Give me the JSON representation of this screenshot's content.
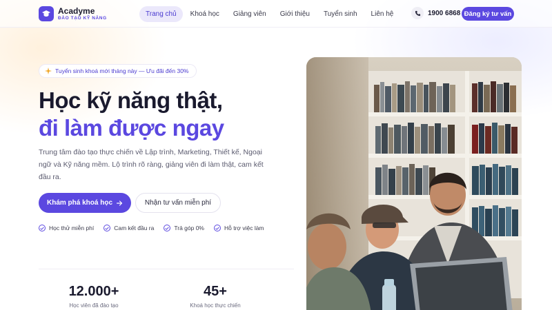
{
  "brand": {
    "name": "Acadyme",
    "tagline": "ĐÀO TẠO KỸ NĂNG",
    "accent": "#5b48e0"
  },
  "nav": {
    "items": [
      {
        "label": "Trang chủ",
        "active": true
      },
      {
        "label": "Khoá học",
        "active": false
      },
      {
        "label": "Giảng viên",
        "active": false
      },
      {
        "label": "Giới thiệu",
        "active": false
      },
      {
        "label": "Tuyển sinh",
        "active": false
      },
      {
        "label": "Liên hệ",
        "active": false
      }
    ],
    "phone": "1900 6868",
    "cta": "Đăng ký tư vấn"
  },
  "hero": {
    "badge": "Tuyển sinh khoá mới tháng này — Ưu đãi đến 30%",
    "headline_line1": "Học kỹ năng thật,",
    "headline_line2": "đi làm được ngay",
    "description": "Trung tâm đào tạo thực chiến về Lập trình, Marketing, Thiết kế, Ngoại ngữ và Kỹ năng mềm. Lộ trình rõ ràng, giảng viên đi làm thật, cam kết đầu ra.",
    "primary_button": "Khám phá khoá học",
    "secondary_button": "Nhận tư vấn miễn phí",
    "features": [
      "Học thử miễn phí",
      "Cam kết đầu ra",
      "Trả góp 0%",
      "Hỗ trợ việc làm"
    ]
  },
  "stats": [
    {
      "value": "12.000+",
      "label": "Học viên đã đào tạo"
    },
    {
      "value": "45+",
      "label": "Khoá học thực chiến"
    }
  ],
  "icons": {
    "logo": "graduation-cap-icon",
    "phone": "phone-icon",
    "badge": "sparkle-icon",
    "arrow": "arrow-right-icon",
    "check": "check-circle-icon"
  }
}
